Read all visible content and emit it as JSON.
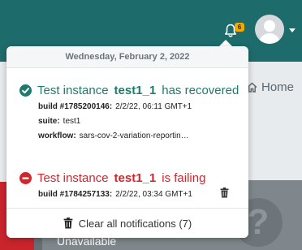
{
  "header": {
    "notification_count": "6"
  },
  "page": {
    "home_label": "Home",
    "unavailable_label": "Unavailable"
  },
  "notifications": {
    "date_header": "Wednesday, February 2, 2022",
    "items": [
      {
        "status": "recovered",
        "prefix": "Test instance",
        "instance": "test1_1",
        "suffix": "has recovered",
        "build_key": "build #1785200146:",
        "build_value": "2/2/22, 06:11 GMT+1",
        "suite_key": "suite:",
        "suite_value": "test1",
        "workflow_key": "workflow:",
        "workflow_value": "sars-cov-2-variation-reportin…"
      },
      {
        "status": "failing",
        "prefix": "Test instance",
        "instance": "test1_1",
        "suffix": "is failing",
        "build_key": "build #1784257133:",
        "build_value": "2/2/22, 03:34 GMT+1"
      }
    ],
    "clear_all_label": "Clear all notifications (7)"
  },
  "colors": {
    "topbar": "#1e6b6b",
    "success": "#1e7a6e",
    "danger": "#d0262e",
    "badge": "#f2a900"
  }
}
